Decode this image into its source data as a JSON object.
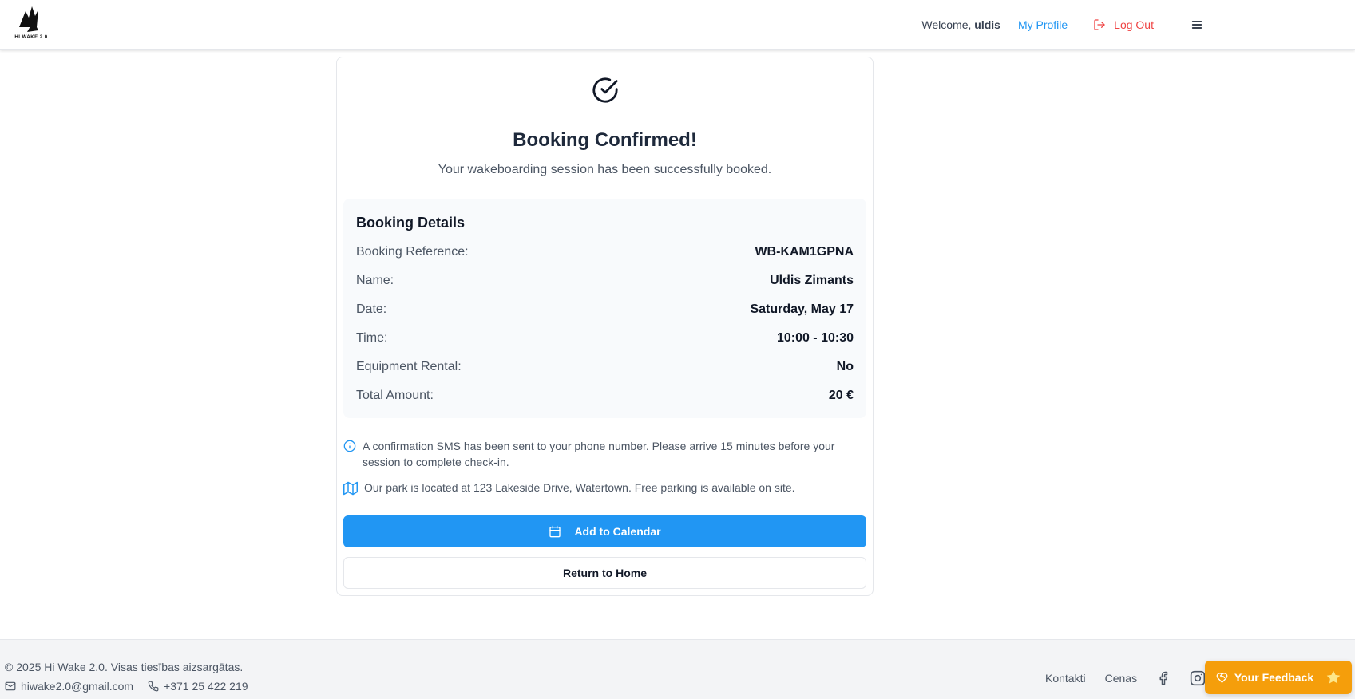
{
  "header": {
    "logo_text": "HI WAKE 2.0",
    "welcome_prefix": "Welcome, ",
    "username": "uldis",
    "profile_label": "My Profile",
    "logout_label": "Log Out"
  },
  "confirmation": {
    "title": "Booking Confirmed!",
    "subtitle": "Your wakeboarding session has been successfully booked."
  },
  "details": {
    "title": "Booking Details",
    "rows": [
      {
        "label": "Booking Reference:",
        "value": "WB-KAM1GPNA"
      },
      {
        "label": "Name:",
        "value": "Uldis Zimants"
      },
      {
        "label": "Date:",
        "value": "Saturday, May 17"
      },
      {
        "label": "Time:",
        "value": "10:00 - 10:30"
      },
      {
        "label": "Equipment Rental:",
        "value": "No"
      },
      {
        "label": "Total Amount:",
        "value": "20 €"
      }
    ]
  },
  "notices": {
    "sms": "A confirmation SMS has been sent to your phone number. Please arrive 15 minutes before your session to complete check-in.",
    "location": "Our park is located at 123 Lakeside Drive, Watertown. Free parking is available on site."
  },
  "actions": {
    "calendar_label": "Add to Calendar",
    "home_label": "Return to Home"
  },
  "footer": {
    "copyright": "© 2025 Hi Wake 2.0. Visas tiesības aizsargātas.",
    "email": "hiwake2.0@gmail.com",
    "phone": "+371 25 422 219",
    "link_contacts": "Kontakti",
    "link_prices": "Cenas"
  },
  "feedback": {
    "label": "Your Feedback"
  },
  "colors": {
    "primary": "#2196f3",
    "danger": "#ef4444",
    "feedback": "#f59e0b"
  }
}
